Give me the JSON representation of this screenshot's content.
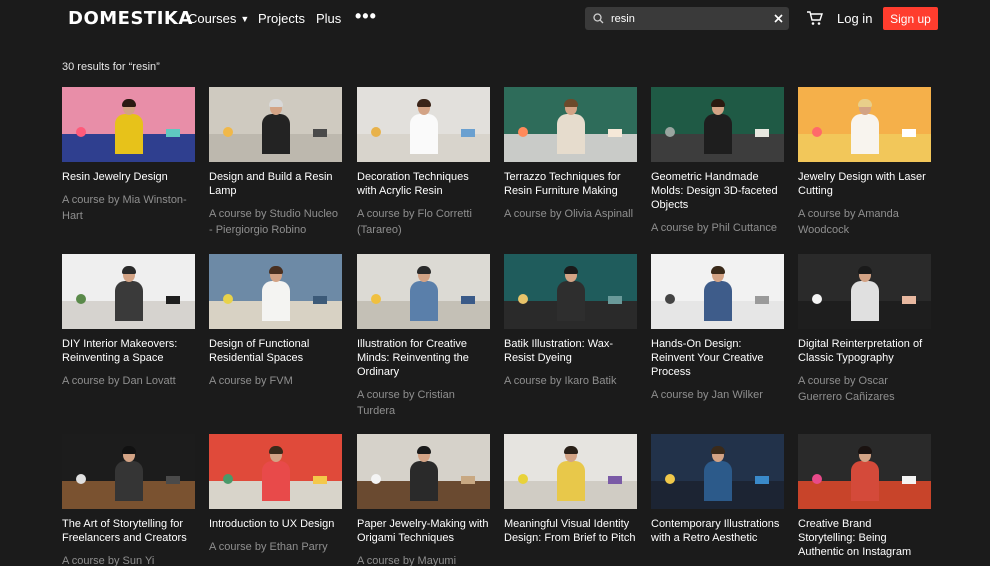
{
  "header": {
    "logo": "DOMESTIKA",
    "nav": {
      "courses": "Courses",
      "projects": "Projects",
      "plus": "Plus",
      "more": "•••"
    },
    "search": {
      "value": "resin",
      "placeholder": ""
    },
    "login": "Log in",
    "signup": "Sign up",
    "accent": "#ff3d2e"
  },
  "results_text": "30 results for “resin”",
  "courses": [
    {
      "title": "Resin Jewelry Design",
      "author": "A course by Mia Winston-Hart",
      "wall": "#e88ea8",
      "floor": "#2f3f8f",
      "shirt": "#e7c21a",
      "hair": "#2a1a12",
      "d1": "#ff5a7a",
      "d2": "#5fc9c0"
    },
    {
      "title": "Design and Build a Resin Lamp",
      "author": "A course by Studio Nucleo - Piergiorgio Robino",
      "wall": "#cfcac0",
      "floor": "#bdb8ae",
      "shirt": "#232323",
      "hair": "#d8d8d8",
      "d1": "#f0b84a",
      "d2": "#4a4a4a"
    },
    {
      "title": "Decoration Techniques with Acrylic Resin",
      "author": "A course by Flo Corretti (Tarareo)",
      "wall": "#e2e0dc",
      "floor": "#d8d4cc",
      "shirt": "#fafafa",
      "hair": "#3a2418",
      "d1": "#e8b24a",
      "d2": "#6aa0d0"
    },
    {
      "title": "Terrazzo Techniques for Resin Furniture Making",
      "author": "A course by Olivia Aspinall",
      "wall": "#2e6c5a",
      "floor": "#c9cbc8",
      "shirt": "#e6dccd",
      "hair": "#6b4a2b",
      "d1": "#ff8a5a",
      "d2": "#f5e8d8"
    },
    {
      "title": "Geometric Handmade Molds: Design 3D-faceted Objects",
      "author": "A course by Phil Cuttance",
      "wall": "#1f5a45",
      "floor": "#3d3d3d",
      "shirt": "#1e1e1e",
      "hair": "#2a1a10",
      "d1": "#9aa5a0",
      "d2": "#e8e8e0"
    },
    {
      "title": "Jewelry Design with Laser Cutting",
      "author": "A course by Amanda Woodcock",
      "wall": "#f5b04a",
      "floor": "#f2c75a",
      "shirt": "#f8f4ee",
      "hair": "#e8cf8a",
      "d1": "#ff6a6a",
      "d2": "#ffffff"
    },
    {
      "title": "DIY Interior Makeovers: Reinventing a Space",
      "author": "A course by Dan Lovatt",
      "wall": "#efefef",
      "floor": "#d6d3cf",
      "shirt": "#3a3a3a",
      "hair": "#2a2a2a",
      "d1": "#5a8a4a",
      "d2": "#1e1e1e"
    },
    {
      "title": "Design of Functional Residential Spaces",
      "author": "A course by FVM",
      "wall": "#6d8aa6",
      "floor": "#d8d2c4",
      "shirt": "#f4f4f2",
      "hair": "#4a3020",
      "d1": "#e8d24a",
      "d2": "#3c5a78"
    },
    {
      "title": "Illustration for Creative Minds: Reinventing the Ordinary",
      "author": "A course by Cristian Turdera",
      "wall": "#dcdad4",
      "floor": "#c4c0b6",
      "shirt": "#5a7faa",
      "hair": "#2a2a2a",
      "d1": "#f0c040",
      "d2": "#3a5a88"
    },
    {
      "title": "Batik Illustration: Wax-Resist Dyeing",
      "author": "A course by Ikaro Batik",
      "wall": "#1f5c5c",
      "floor": "#2a2a2a",
      "shirt": "#2e2e2e",
      "hair": "#1a1a1a",
      "d1": "#e8c46a",
      "d2": "#6a9a9a"
    },
    {
      "title": "Hands-On Design: Reinvent Your Creative Process",
      "author": "A course by Jan Wilker",
      "wall": "#f2f2f2",
      "floor": "#e6e6e6",
      "shirt": "#3e5c8a",
      "hair": "#3a2a1a",
      "d1": "#444444",
      "d2": "#9a9a9a"
    },
    {
      "title": "Digital Reinterpretation of Classic Typography",
      "author": "A course by Oscar Guerrero Cañizares",
      "wall": "#2a2a2a",
      "floor": "#1e1e1e",
      "shirt": "#e0e0e0",
      "hair": "#1a1a1a",
      "d1": "#f4f4f4",
      "d2": "#e8b8a0"
    },
    {
      "title": "The Art of Storytelling for Freelancers and Creators",
      "author": "A course by Sun Yi",
      "wall": "#1c1c1c",
      "floor": "#7a5230",
      "shirt": "#353535",
      "hair": "#111111",
      "d1": "#e0e0e0",
      "d2": "#4a4a4a"
    },
    {
      "title": "Introduction to UX Design",
      "author": "A course by Ethan Parry",
      "wall": "#e04a3a",
      "floor": "#d8d4ca",
      "shirt": "#e84a4a",
      "hair": "#3a2a1a",
      "d1": "#4a9a6a",
      "d2": "#f4c84a"
    },
    {
      "title": "Paper Jewelry-Making with Origami Techniques",
      "author": "A course by Mayumi",
      "wall": "#d6d2ca",
      "floor": "#6a4a30",
      "shirt": "#2a2a2a",
      "hair": "#1a1a1a",
      "d1": "#f4f4f4",
      "d2": "#c8a882"
    },
    {
      "title": "Meaningful Visual Identity Design: From Brief to Pitch",
      "author": "",
      "wall": "#e6e4e0",
      "floor": "#d0ccc4",
      "shirt": "#e8c84a",
      "hair": "#2a2018",
      "d1": "#e8d23a",
      "d2": "#7a5aa6"
    },
    {
      "title": "Contemporary Illustrations with a Retro Aesthetic",
      "author": "",
      "wall": "#22324a",
      "floor": "#1c2433",
      "shirt": "#2c5a8a",
      "hair": "#3a2a1a",
      "d1": "#f0c84a",
      "d2": "#3a8aca"
    },
    {
      "title": "Creative Brand Storytelling: Being Authentic on Instagram",
      "author": "",
      "wall": "#2a2a2a",
      "floor": "#c8442a",
      "shirt": "#d44a3a",
      "hair": "#1a1210",
      "d1": "#e84a8a",
      "d2": "#f4f4f4"
    }
  ]
}
